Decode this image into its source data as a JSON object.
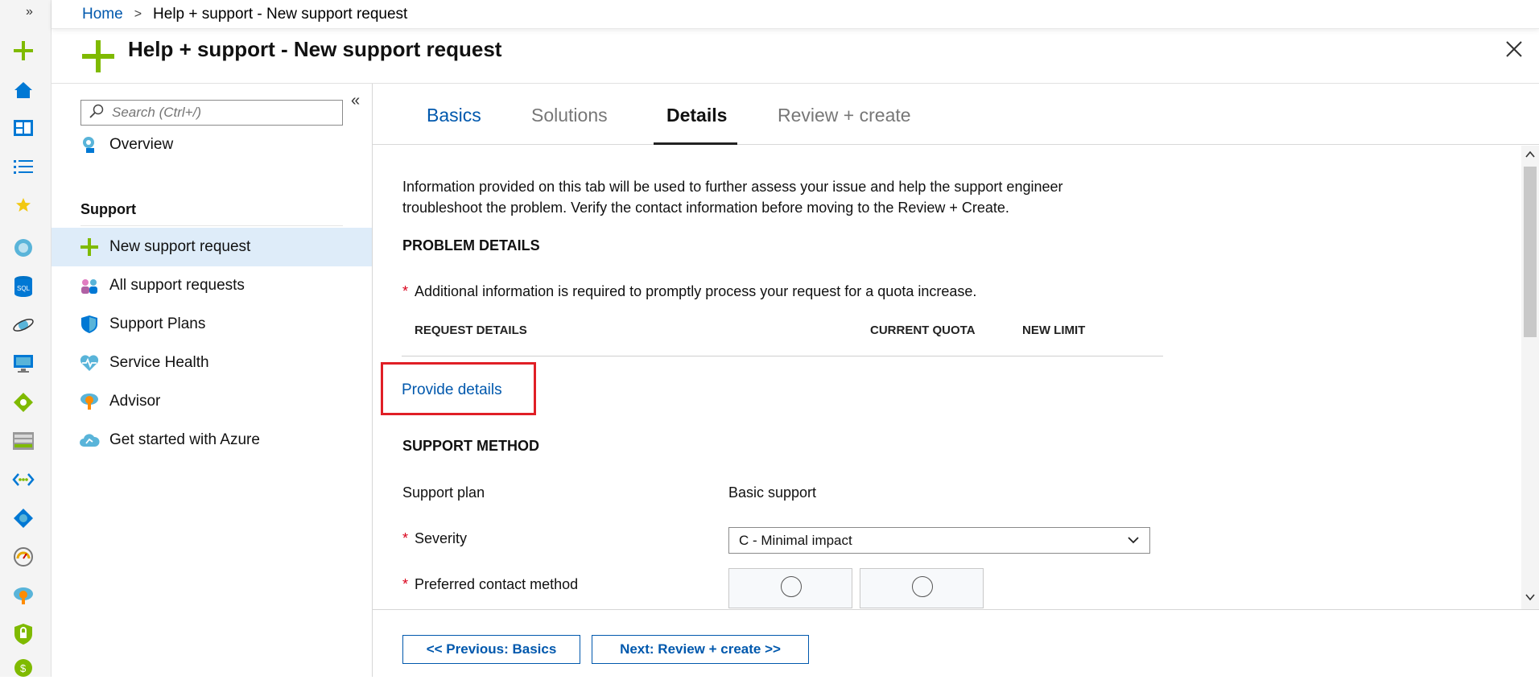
{
  "breadcrumb": {
    "home": "Home",
    "current": "Help + support - New support request"
  },
  "blade": {
    "title": "Help + support - New support request"
  },
  "menu": {
    "search_placeholder": "Search (Ctrl+/)",
    "overview": "Overview",
    "section": "Support",
    "items": [
      {
        "label": "New support request",
        "icon": "plus-icon",
        "active": true
      },
      {
        "label": "All support requests",
        "icon": "people-icon"
      },
      {
        "label": "Support Plans",
        "icon": "shield-icon"
      },
      {
        "label": "Service Health",
        "icon": "heart-pulse-icon"
      },
      {
        "label": "Advisor",
        "icon": "advisor-icon"
      },
      {
        "label": "Get started with Azure",
        "icon": "cloud-icon"
      }
    ]
  },
  "tabs": [
    "Basics",
    "Solutions",
    "Details",
    "Review + create"
  ],
  "selected_tab": "Details",
  "details": {
    "intro_line1": "Information provided on this tab will be used to further assess your issue and help the support engineer",
    "intro_line2": "troubleshoot the problem. Verify the contact information before moving to the Review + Create.",
    "problem_header": "PROBLEM DETAILS",
    "quota_note": "Additional information is required to promptly process your request for a quota increase.",
    "columns": [
      "REQUEST DETAILS",
      "CURRENT QUOTA",
      "NEW LIMIT"
    ],
    "provide_link": "Provide details",
    "support_header": "SUPPORT METHOD",
    "support_plan_label": "Support plan",
    "support_plan_value": "Basic support",
    "severity_label": "Severity",
    "severity_value": "C - Minimal impact",
    "contact_label": "Preferred contact method"
  },
  "footer": {
    "prev": "<< Previous: Basics",
    "next": "Next: Review + create >>"
  },
  "colors": {
    "accent": "#0058ad",
    "green": "#7fba00",
    "highlight": "#e01f26",
    "active_bg": "#deecf9"
  }
}
